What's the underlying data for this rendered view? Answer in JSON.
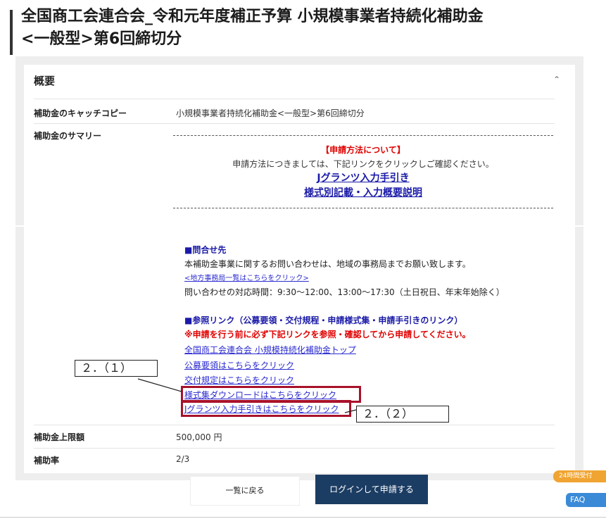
{
  "page": {
    "title_line1": "全国商工会連合会_令和元年度補正予算 小規模事業者持続化補助金",
    "title_line2": "<一般型>第6回締切分"
  },
  "overview": {
    "heading": "概要",
    "catch_label": "補助金のキャッチコピー",
    "catch_value": "小規模事業者持続化補助金<一般型>第6回締切分",
    "summary_label": "補助金のサマリー",
    "apply_heading": "【申請方法について】",
    "apply_text": "申請方法につきましては、下記リンクをクリックしご確認ください。",
    "link_jgrants": "Jグランツ入力手引き",
    "link_forms": "様式別記載・入力概要説明"
  },
  "contact": {
    "heading": "■問合せ先",
    "text1": "本補助金事業に関するお問い合わせは、地域の事務局までお願い致します。",
    "link_regional": "<地方事務局一覧はこちらをクリック>",
    "hours": "問い合わせの対応時間：9:30〜12:00、13:00〜17:30（土日祝日、年末年始除く）"
  },
  "refs": {
    "heading": "■参照リンク（公募要領・交付規程・申請様式集・申請手引きのリンク）",
    "warning": "※申請を行う前に必ず下記リンクを参照・確認してから申請してください。",
    "links": [
      "全国商工会連合会 小規模持続化補助金トップ",
      "公募要領はこちらをクリック",
      "交付規定はこちらをクリック",
      "様式集ダウンロードはこちらをクリック",
      "Jグランツ入力手引きはこちらをクリック"
    ]
  },
  "annotations": {
    "label1": "２．（１）",
    "label2": "２．（２）",
    "color": "#a8112a"
  },
  "details": {
    "limit_label": "補助金上限額",
    "limit_value": "500,000 円",
    "rate_label": "補助率",
    "rate_value": "2/3"
  },
  "footer": {
    "back_label": "一覧に戻る",
    "login_label": "ログインして申請する",
    "badge_label": "24時間受付",
    "faq_label": "FAQ"
  },
  "icons": {
    "collapse": "chevron-up-icon"
  }
}
